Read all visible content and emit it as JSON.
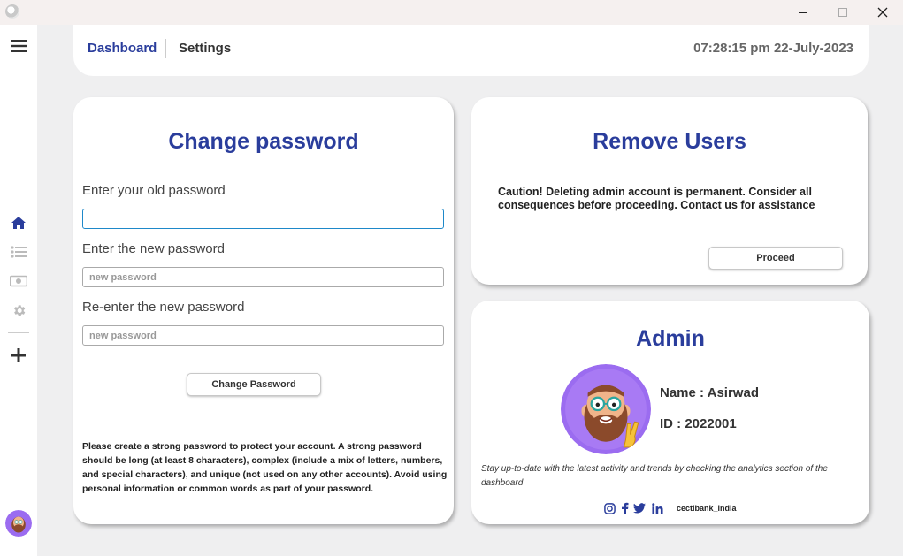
{
  "nav": {
    "dashboard": "Dashboard",
    "settings": "Settings",
    "clock": "07:28:15 pm 22-July-2023"
  },
  "sidebar": {
    "items": [
      {
        "icon": "menu-icon"
      },
      {
        "icon": "home-icon"
      },
      {
        "icon": "list-icon"
      },
      {
        "icon": "money-icon"
      },
      {
        "icon": "gear-icon"
      },
      {
        "icon": "plus-icon"
      }
    ]
  },
  "change_password": {
    "title": "Change password",
    "old_label": "Enter your old password",
    "old_value": "",
    "new_label": "Enter the new password",
    "new_placeholder": "new password",
    "reenter_label": "Re-enter the new password",
    "reenter_placeholder": "new password",
    "button": "Change Password",
    "hint": "Please create a strong password to protect your account. A strong password should be long (at least 8 characters), complex (include a mix of letters, numbers, and special characters), and unique (not used on any other accounts). Avoid using personal information or common words as part of your password."
  },
  "remove_users": {
    "title": "Remove Users",
    "caution": "Caution! Deleting admin account is permanent. Consider all consequences before proceeding. Contact us for assistance",
    "button": "Proceed"
  },
  "admin": {
    "title": "Admin",
    "name": "Name : Asirwad",
    "id": "ID : 2022001",
    "note": "Stay up-to-date with the latest activity and trends by checking the analytics section of the dashboard",
    "handle": "cectlbank_india"
  },
  "colors": {
    "accent": "#2a3d9c",
    "focus": "#1e88c9",
    "avatar_bg": "#9b6cf0"
  }
}
